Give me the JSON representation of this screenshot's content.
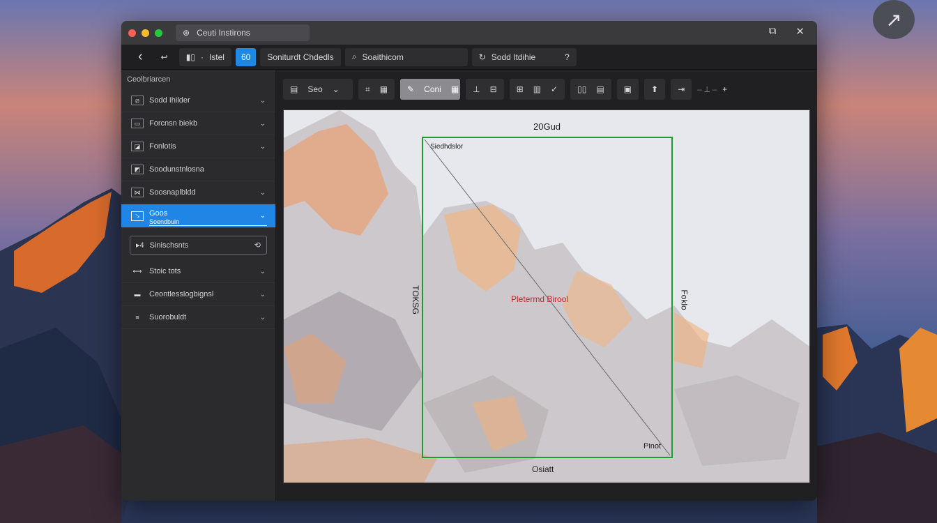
{
  "window": {
    "tab_title": "Ceuti Instirons",
    "restore_icon": "⧉",
    "close_icon": "✕"
  },
  "toolbar1": {
    "back_icon": "‹",
    "back2_icon": "↩",
    "item1_label": "Istel",
    "item1_icon": "▮▯",
    "blue_label": "60",
    "item2_label": "Soniturdt Chdedls",
    "search_label": "Soaithicom",
    "item4_label": "Sodd Itdihie",
    "item4_suffix": "?"
  },
  "sidebar": {
    "title": "Ceolbriarcen",
    "items": [
      {
        "label": "Sodd Ihilder",
        "icon": "⧄"
      },
      {
        "label": "Forcnsn biekb",
        "icon": "▭"
      },
      {
        "label": "Fonlotis",
        "icon": "◪"
      },
      {
        "label": "Soodunstnlosna",
        "icon": "◩"
      },
      {
        "label": "Soosnaplbldd",
        "icon": "⋈"
      }
    ],
    "active": {
      "label": "Goos",
      "sub": "Soendbuin",
      "icon": "↘"
    },
    "field": {
      "label": "Sinischsnts",
      "icon": "▸4",
      "trail": "⟲"
    },
    "items2": [
      {
        "label": "Stoic tots",
        "icon": "⟷"
      },
      {
        "label": "Ceontlesslogbignsl",
        "icon": "▬"
      },
      {
        "label": "Suorobuldt",
        "icon": "≡"
      }
    ]
  },
  "toolbar2": {
    "g1_label": "Seo",
    "g3_label": "Coni"
  },
  "canvas": {
    "top_label": "20Gud",
    "corner_tl": "Siedhdslor",
    "left_label": "TOKSG",
    "right_label": "Foklo",
    "center_label": "Pletermd Birool",
    "corner_br": "Pinot",
    "bottom_label": "Osiatt"
  },
  "desktop": {
    "corner_icon": "↗"
  }
}
